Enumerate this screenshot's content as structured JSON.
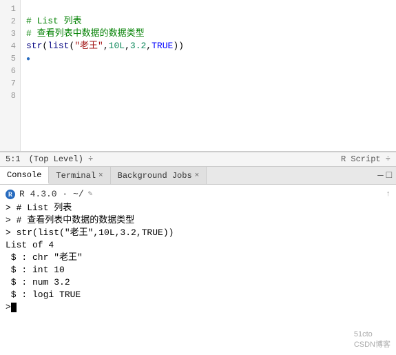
{
  "editor": {
    "lines": [
      {
        "num": "1",
        "content": [],
        "raw": ""
      },
      {
        "num": "2",
        "content": [
          {
            "type": "comment",
            "text": "# List 列表"
          }
        ],
        "raw": "# List 列表"
      },
      {
        "num": "3",
        "content": [
          {
            "type": "comment",
            "text": "# 查看列表中数据的数据类型"
          }
        ],
        "raw": "# 查看列表中数据的数据类型"
      },
      {
        "num": "4",
        "content": [
          {
            "type": "mixed",
            "text": "str(list(\"老王\",10L,3.2,TRUE))"
          }
        ],
        "raw": "str(list(\"老王\",10L,3.2,TRUE))"
      },
      {
        "num": "5",
        "content": [],
        "raw": ""
      },
      {
        "num": "6",
        "content": [],
        "raw": ""
      },
      {
        "num": "7",
        "content": [],
        "raw": ""
      },
      {
        "num": "8",
        "content": [],
        "raw": ""
      }
    ]
  },
  "status_bar": {
    "position": "5:1",
    "level": "(Top Level) ÷",
    "script_type": "R Script ÷"
  },
  "tabs": [
    {
      "label": "Console",
      "closeable": false,
      "active": true
    },
    {
      "label": "Terminal",
      "closeable": true,
      "active": false
    },
    {
      "label": "Background Jobs",
      "closeable": true,
      "active": false
    }
  ],
  "console": {
    "version_line": "R 4.3.0 · ~/",
    "r_version": "R 4.3.0",
    "path": "~/",
    "lines": [
      {
        "type": "prompt",
        "text": "> # List 列表"
      },
      {
        "type": "prompt",
        "text": "> # 查看列表中数据的数据类型"
      },
      {
        "type": "prompt",
        "text": "> str(list(\"老王\",10L,3.2,TRUE))"
      },
      {
        "type": "output",
        "text": "List of 4"
      },
      {
        "type": "output",
        "text": " $ : chr \"老王\""
      },
      {
        "type": "output",
        "text": " $ : int 10"
      },
      {
        "type": "output",
        "text": " $ : num 3.2"
      },
      {
        "type": "output",
        "text": " $ : logi TRUE"
      },
      {
        "type": "prompt_empty",
        "text": ">"
      }
    ]
  },
  "watermark": {
    "line1": "51cto",
    "line2": "CSDN博客"
  },
  "icons": {
    "minimize": "—",
    "maximize": "□",
    "close": "×",
    "pencil": "✎",
    "arrow_up": "↑"
  }
}
